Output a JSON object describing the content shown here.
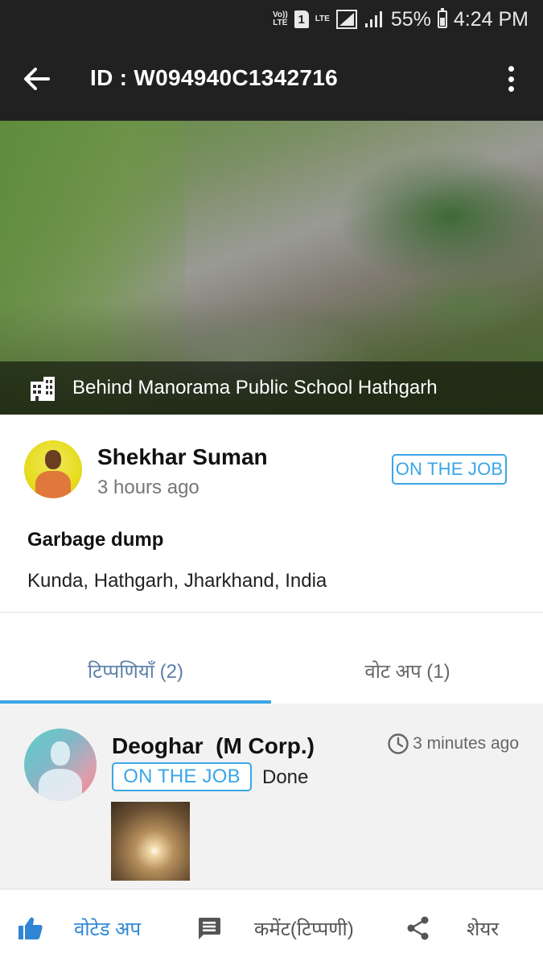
{
  "status_bar": {
    "volte_label": "Vo)) LTE",
    "sim_slot": "1",
    "lte_label": "LTE",
    "battery_percent": "55%",
    "battery_level": 0.55,
    "time": "4:24 PM"
  },
  "app_bar": {
    "title": "ID : W094940C1342716",
    "back_icon": "arrow-left-icon",
    "more_icon": "more-vert-icon"
  },
  "hero": {
    "location": "Behind Manorama Public School Hathgarh",
    "location_icon": "building-icon"
  },
  "report": {
    "user_name": "Shekhar Suman",
    "posted_time": "3 hours ago",
    "status": "ON THE JOB",
    "category": "Garbage dump",
    "address": "Kunda, Hathgarh, Jharkhand, India"
  },
  "tabs": [
    {
      "label": "टिप्पणियाँ (2)",
      "active": true
    },
    {
      "label": "वोट अप (1)",
      "active": false
    }
  ],
  "comments": [
    {
      "author": "Deoghar  (M Corp.)",
      "time": "3 minutes ago",
      "status": "ON THE JOB",
      "text": "Done"
    }
  ],
  "actions": {
    "vote_label": "वोटेड अप",
    "comment_label": "कमेंट(टिप्पणी)",
    "share_label": "शेयर"
  },
  "colors": {
    "accent": "#3aa6e6",
    "vote_blue": "#2e86d4",
    "app_bar": "#212121"
  }
}
